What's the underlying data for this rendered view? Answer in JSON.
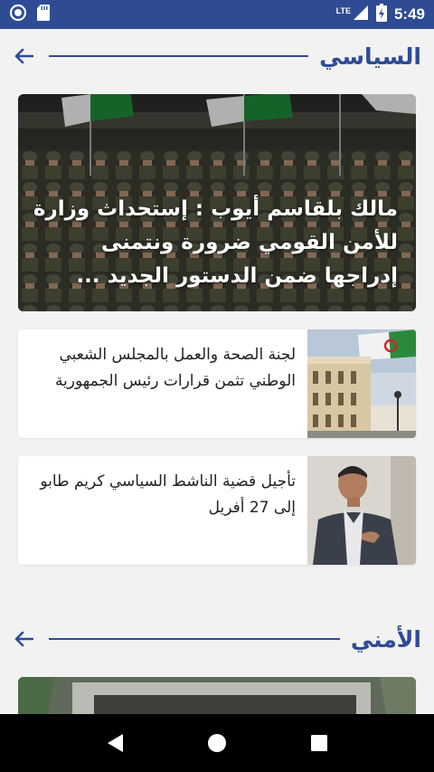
{
  "status_bar": {
    "time": "5:49",
    "network": "LTE",
    "left_icons": [
      "circle-notification-icon",
      "sd-card-icon"
    ],
    "right_icons": [
      "signal-icon",
      "battery-icon"
    ]
  },
  "sections": [
    {
      "title": "السياسي",
      "hero": {
        "title": "مالك بلقاسم أيوب : إستحداث وزارة للأمن القومي ضرورة ونتمنى إدراجها ضمن الدستور الجديد ..."
      },
      "articles": [
        {
          "title": "لجنة الصحة والعمل بالمجلس الشعبي الوطني تثمن قرارات رئيس الجمهورية"
        },
        {
          "title": "تأجيل قضية الناشط السياسي كريم طابو إلى 27 أفريل"
        }
      ]
    },
    {
      "title": "الأمني"
    }
  ],
  "colors": {
    "accent": "#2f4b94",
    "background": "#f2f2f2"
  }
}
